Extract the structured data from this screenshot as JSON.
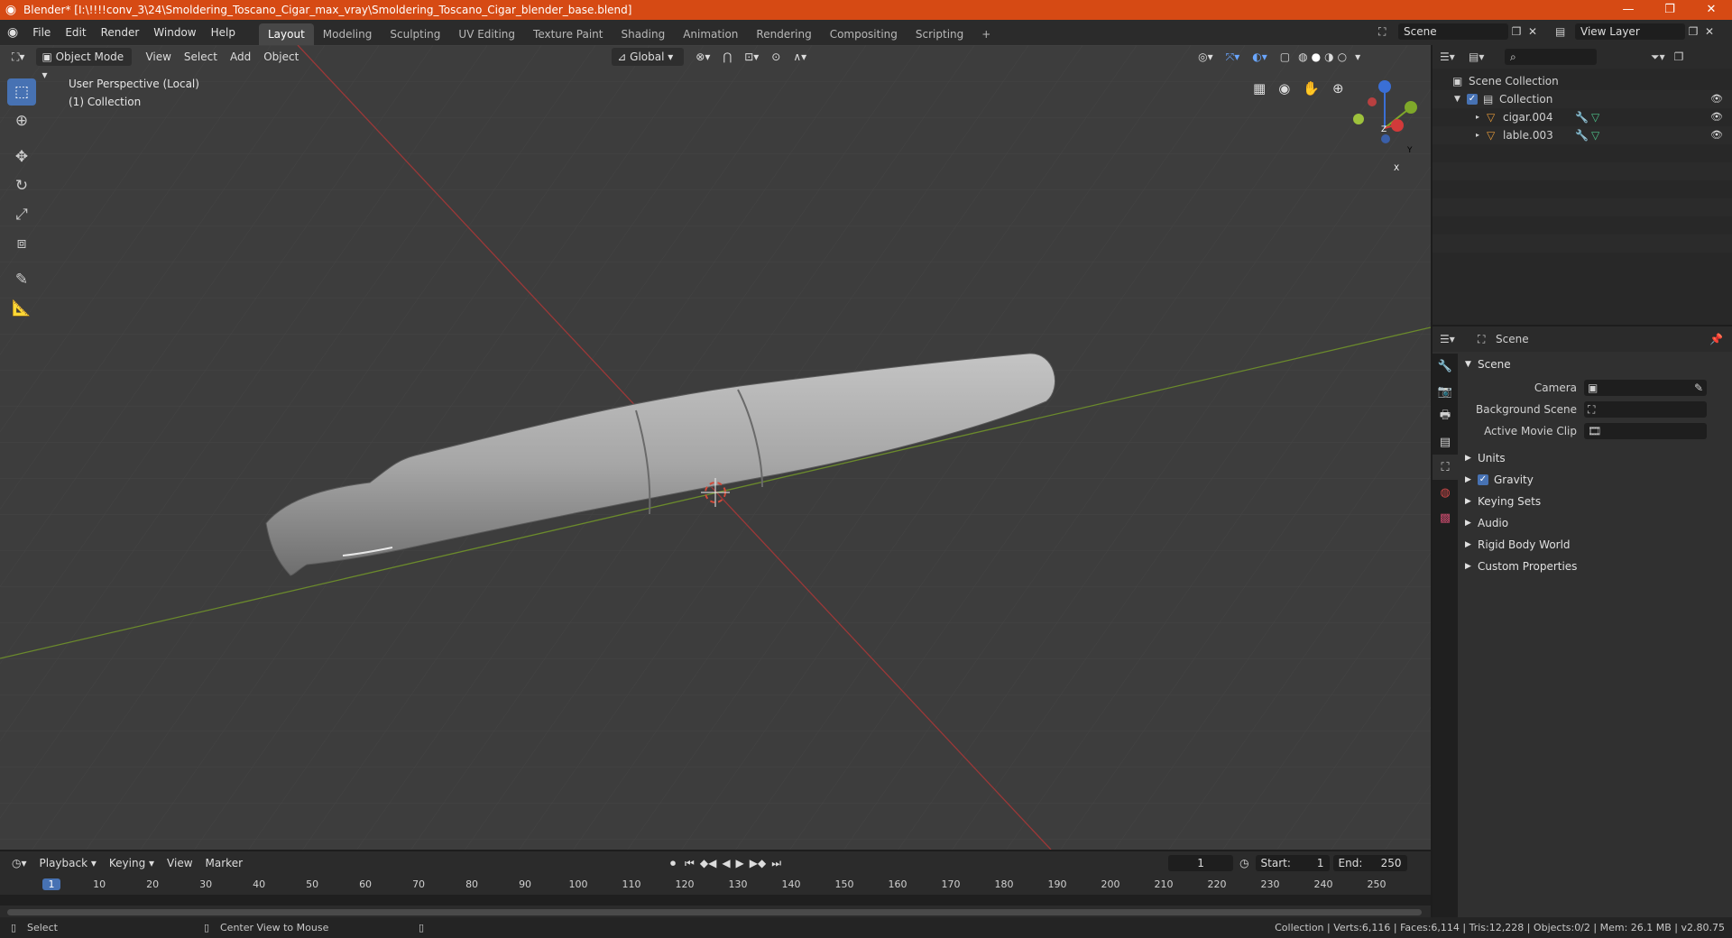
{
  "window": {
    "title": "Blender* [I:\\!!!!conv_3\\24\\Smoldering_Toscano_Cigar_max_vray\\Smoldering_Toscano_Cigar_blender_base.blend]",
    "minimize": "—",
    "maximize": "❐",
    "close": "✕"
  },
  "menu": [
    "File",
    "Edit",
    "Render",
    "Window",
    "Help"
  ],
  "workspaces": [
    "Layout",
    "Modeling",
    "Sculpting",
    "UV Editing",
    "Texture Paint",
    "Shading",
    "Animation",
    "Rendering",
    "Compositing",
    "Scripting"
  ],
  "workspace_add": "+",
  "scene_field": "Scene",
  "view_layer_field": "View Layer",
  "viewport": {
    "mode": "Object Mode",
    "menus": [
      "View",
      "Select",
      "Add",
      "Object"
    ],
    "transform_orientation": "Global",
    "overlay_line1": "User Perspective (Local)",
    "overlay_line2": "(1) Collection",
    "gizmo_axes": {
      "z": "Z",
      "y": "Y",
      "x": "X"
    }
  },
  "outliner": {
    "root": "Scene Collection",
    "collection": "Collection",
    "items": [
      "cigar.004",
      "lable.003"
    ]
  },
  "properties": {
    "header": "Scene",
    "panel": "Scene",
    "fields": [
      {
        "label": "Camera"
      },
      {
        "label": "Background Scene"
      },
      {
        "label": "Active Movie Clip"
      }
    ],
    "subpanels": [
      "Units",
      "Gravity",
      "Keying Sets",
      "Audio",
      "Rigid Body World",
      "Custom Properties"
    ]
  },
  "timeline": {
    "menus": [
      "Playback",
      "Keying",
      "View",
      "Marker"
    ],
    "current_frame": "1",
    "start_label": "Start:",
    "start": "1",
    "end_label": "End:",
    "end": "250",
    "ticks": [
      "1",
      "10",
      "20",
      "30",
      "40",
      "50",
      "60",
      "70",
      "80",
      "90",
      "100",
      "110",
      "120",
      "130",
      "140",
      "150",
      "160",
      "170",
      "180",
      "190",
      "200",
      "210",
      "220",
      "230",
      "240",
      "250"
    ]
  },
  "status": {
    "left1": "Select",
    "left2": "Center View to Mouse",
    "right": "Collection | Verts:6,116 | Faces:6,114 | Tris:12,228 | Objects:0/2 | Mem: 26.1 MB | v2.80.75"
  }
}
